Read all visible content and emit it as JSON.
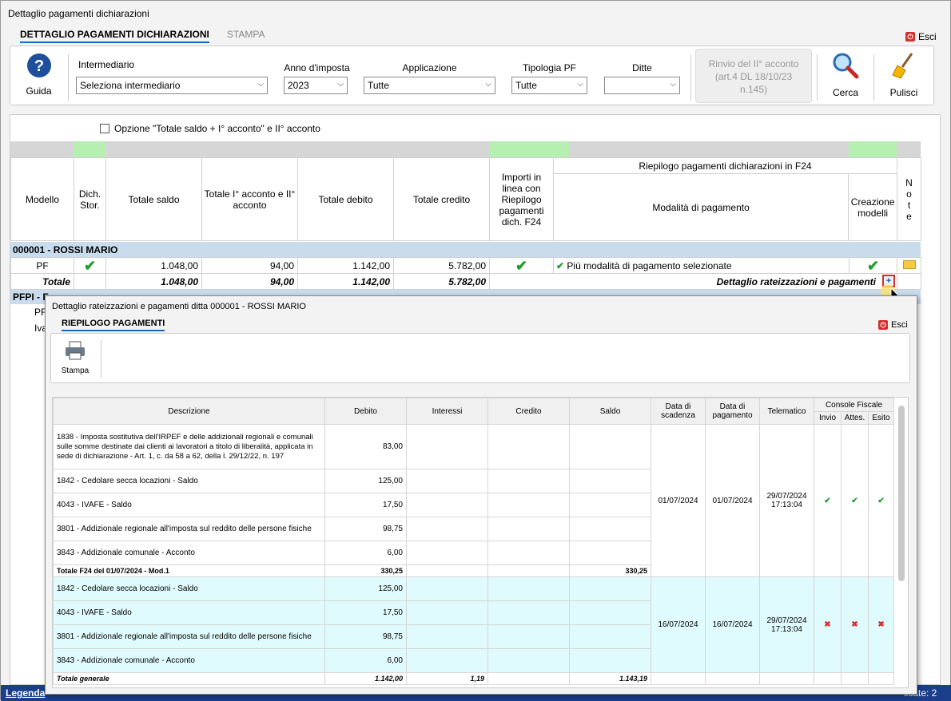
{
  "window": {
    "title": "Dettaglio pagamenti dichiarazioni"
  },
  "tabs": [
    {
      "label": "DETTAGLIO PAGAMENTI DICHIARAZIONI"
    },
    {
      "label": "STAMPA"
    }
  ],
  "esci_label": "Esci",
  "toolbar": {
    "guida": "Guida",
    "intermediario_label": "Intermediario",
    "intermediario_value": "Seleziona intermediario",
    "anno_label": "Anno d'imposta",
    "anno_value": "2023",
    "applicazione_label": "Applicazione",
    "applicazione_value": "Tutte",
    "tipologia_label": "Tipologia PF",
    "tipologia_value": "Tutte",
    "ditte_label": "Ditte",
    "ditte_value": "",
    "rinvio_line1": "Rinvio del II° acconto",
    "rinvio_line2": "(art.4 DL 18/10/23",
    "rinvio_line3": "n.145)",
    "cerca": "Cerca",
    "pulisci": "Pulisci"
  },
  "option_label": "Opzione \"Totale saldo + I° acconto\" e II° acconto",
  "grid": {
    "headers": {
      "modello": "Modello",
      "dich1": "Dich.",
      "dich2": "Stor.",
      "totale_saldo": "Totale saldo",
      "acc1": "Totale I° acconto e II°",
      "acc2": "acconto",
      "totale_debito": "Totale debito",
      "totale_credito": "Totale credito",
      "imp1": "Importi in",
      "imp2": "linea con",
      "imp3": "Riepilogo",
      "imp4": "pagamenti",
      "imp5": "dich. F24",
      "riepilogo": "Riepilogo pagamenti dichiarazioni in F24",
      "modalita": "Modalità di pagamento",
      "creazione1": "Creazione",
      "creazione2": "modelli",
      "note": "N o t e"
    },
    "group1": "000001 - ROSSI MARIO",
    "row_pf": {
      "modello": "PF",
      "saldo": "1.048,00",
      "acconto": "94,00",
      "debito": "1.142,00",
      "credito": "5.782,00",
      "modalita": "Più modalità di pagamento selezionate"
    },
    "row_totale": {
      "label": "Totale",
      "saldo": "1.048,00",
      "acconto": "94,00",
      "debito": "1.142,00",
      "credito": "5.782,00",
      "dettaglio": "Dettaglio rateizzazioni e pagamenti"
    },
    "group2": "PFPI - F",
    "row_pf2": "PF",
    "row_iva": "Iva"
  },
  "status": {
    "legenda": "Legenda",
    "right": "licate: 2"
  },
  "popup": {
    "title": "Dettaglio rateizzazioni e pagamenti ditta 000001 - ROSSI MARIO",
    "tab": "RIEPILOGO PAGAMENTI",
    "esci": "Esci",
    "stampa": "Stampa",
    "headers": {
      "descrizione": "Descrizione",
      "debito": "Debito",
      "interessi": "Interessi",
      "credito": "Credito",
      "saldo": "Saldo",
      "scadenza1": "Data di",
      "scadenza2": "scadenza",
      "pagamento1": "Data di",
      "pagamento2": "pagamento",
      "telematico": "Telematico",
      "console": "Console Fiscale",
      "invio": "Invio",
      "attes": "Attes.",
      "esito": "Esito"
    },
    "block1": {
      "rows": [
        {
          "desc": "1838 - Imposta sostitutiva dell'IRPEF e delle addizionali regionali e comunali sulle somme destinate dai clienti ai lavoratori a titolo di liberalità, applicata in sede di dichiarazione - Art. 1, c. da 58 a 62, della l. 29/12/22, n. 197",
          "debito": "83,00"
        },
        {
          "desc": "1842 - Cedolare secca locazioni - Saldo",
          "debito": "125,00"
        },
        {
          "desc": "4043 - IVAFE - Saldo",
          "debito": "17,50"
        },
        {
          "desc": "3801 - Addizionale regionale all'imposta sul reddito delle persone fisiche",
          "debito": "98,75"
        },
        {
          "desc": "3843 - Addizionale comunale - Acconto",
          "debito": "6,00"
        }
      ],
      "scadenza": "01/07/2024",
      "pagamento": "01/07/2024",
      "telematico1": "29/07/2024",
      "telematico2": "17:13:04",
      "total_label": "Totale F24 del 01/07/2024 - Mod.1",
      "total_debito": "330,25",
      "total_saldo": "330,25"
    },
    "block2": {
      "rows": [
        {
          "desc": "1842 - Cedolare secca locazioni - Saldo",
          "debito": "125,00"
        },
        {
          "desc": "4043 - IVAFE - Saldo",
          "debito": "17,50"
        },
        {
          "desc": "3801 - Addizionale regionale all'imposta sul reddito delle persone fisiche",
          "debito": "98,75"
        },
        {
          "desc": "3843 - Addizionale comunale - Acconto",
          "debito": "6,00"
        }
      ],
      "scadenza": "16/07/2024",
      "pagamento": "16/07/2024",
      "telematico1": "29/07/2024",
      "telematico2": "17:13:04"
    },
    "totale_generale": {
      "label": "Totale generale",
      "debito": "1.142,00",
      "interessi": "1,19",
      "saldo": "1.143,19"
    }
  }
}
